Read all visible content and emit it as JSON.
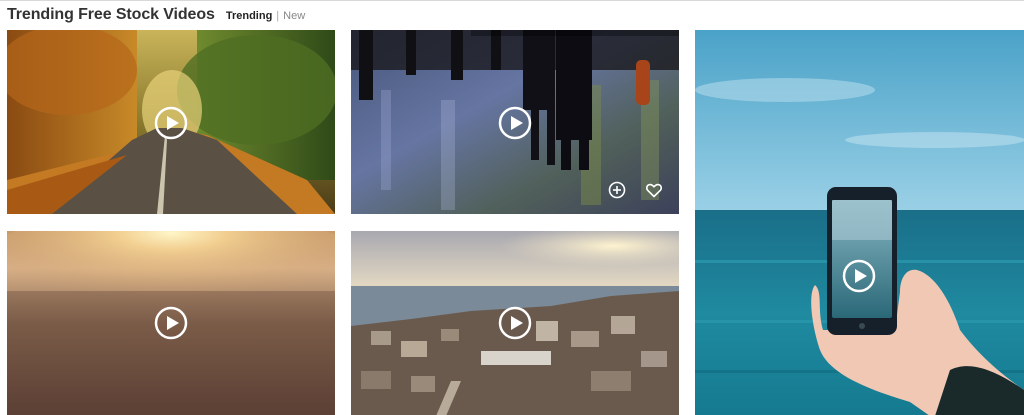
{
  "header": {
    "title": "Trending Free Stock Videos",
    "tabs": [
      {
        "label": "Trending",
        "active": true
      },
      {
        "label": "New",
        "active": false
      }
    ],
    "separator": "|"
  },
  "videos": [
    {
      "subject": "autumn forest road",
      "icon": "play-icon"
    },
    {
      "subject": "people walking on wet pavement",
      "icon": "play-icon",
      "actions": [
        "plus-circle-icon",
        "heart-icon"
      ]
    },
    {
      "subject": "hand holding phone by the ocean",
      "icon": "play-icon"
    },
    {
      "subject": "sunset haze",
      "icon": "play-icon"
    },
    {
      "subject": "coastal town at sunset",
      "icon": "play-icon"
    }
  ],
  "colors": {
    "title": "#333333",
    "ocean": "#1f8aa0",
    "sky": "#64b6d8",
    "overlay_icon": "#ffffff"
  }
}
